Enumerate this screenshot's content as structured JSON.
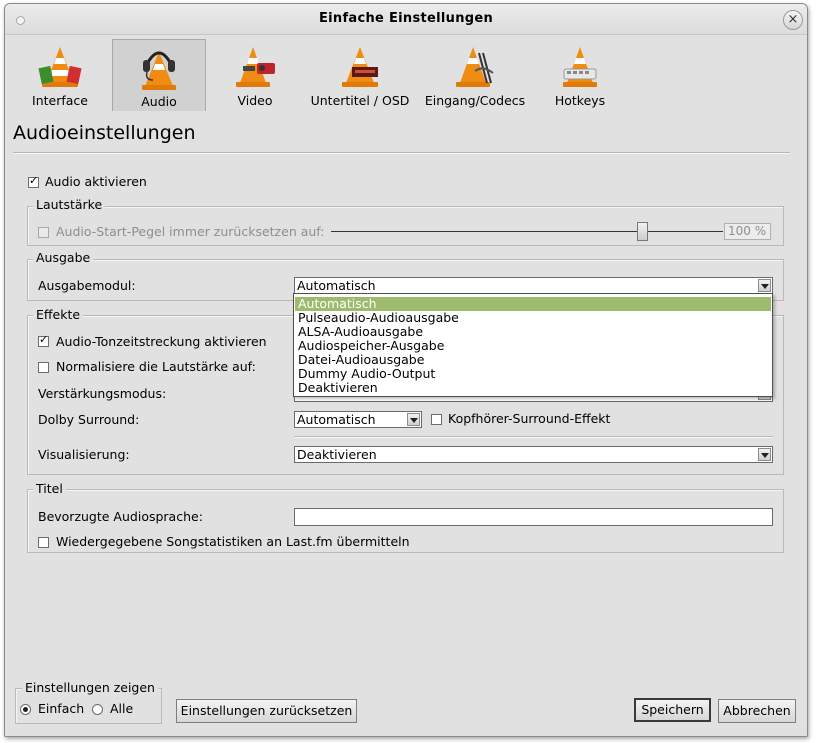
{
  "window": {
    "title": "Einfache Einstellungen"
  },
  "tabs": [
    {
      "label": "Interface",
      "icon": "cone-interface-icon"
    },
    {
      "label": "Audio",
      "icon": "cone-headphones-icon",
      "selected": true
    },
    {
      "label": "Video",
      "icon": "cone-video-icon"
    },
    {
      "label": "Untertitel / OSD",
      "icon": "cone-subtitle-icon"
    },
    {
      "label": "Eingang/Codecs",
      "icon": "cone-codecs-icon"
    },
    {
      "label": "Hotkeys",
      "icon": "cone-hotkeys-icon"
    }
  ],
  "heading": "Audioeinstellungen",
  "audio_enable": {
    "label": "Audio aktivieren",
    "checked": true
  },
  "volume": {
    "group_label": "Lautstärke",
    "reset_label": "Audio-Start-Pegel immer zurücksetzen auf:",
    "checked": false,
    "value_text": "100 %",
    "slider_fraction": 0.79
  },
  "output": {
    "group_label": "Ausgabe",
    "module_label": "Ausgabemodul:",
    "module_value": "Automatisch",
    "options": [
      "Automatisch",
      "Pulseaudio-Audioausgabe",
      "ALSA-Audioausgabe",
      "Audiospeicher-Ausgabe",
      "Datei-Audioausgabe",
      "Dummy Audio-Output",
      "Deaktivieren"
    ],
    "selected_index": 0
  },
  "effects": {
    "group_label": "Effekte",
    "timestretch_label": "Audio-Tonzeitstreckung aktivieren",
    "timestretch_checked": true,
    "normalize_label": "Normalisiere die Lautstärke auf:",
    "normalize_checked": false,
    "replay_label": "Verstärkungsmodus:",
    "dolby_label": "Dolby Surround:",
    "dolby_value": "Automatisch",
    "headphone_label": "Kopfhörer-Surround-Effekt",
    "headphone_checked": false,
    "visual_label": "Visualisierung:",
    "visual_value": "Deaktivieren"
  },
  "tracks": {
    "group_label": "Titel",
    "lang_label": "Bevorzugte Audiosprache:",
    "lang_value": "",
    "lastfm_label": "Wiedergegebene Songstatistiken an Last.fm übermitteln",
    "lastfm_checked": false
  },
  "show_settings": {
    "group_label": "Einstellungen zeigen",
    "simple_label": "Einfach",
    "all_label": "Alle",
    "selected": "Einfach"
  },
  "buttons": {
    "reset": "Einstellungen zurücksetzen",
    "save": "Speichern",
    "cancel": "Abbrechen"
  },
  "colors": {
    "selection": "#9cbb6e",
    "window_bg": "#e1e1e1",
    "cone_orange": "#f08c12"
  }
}
